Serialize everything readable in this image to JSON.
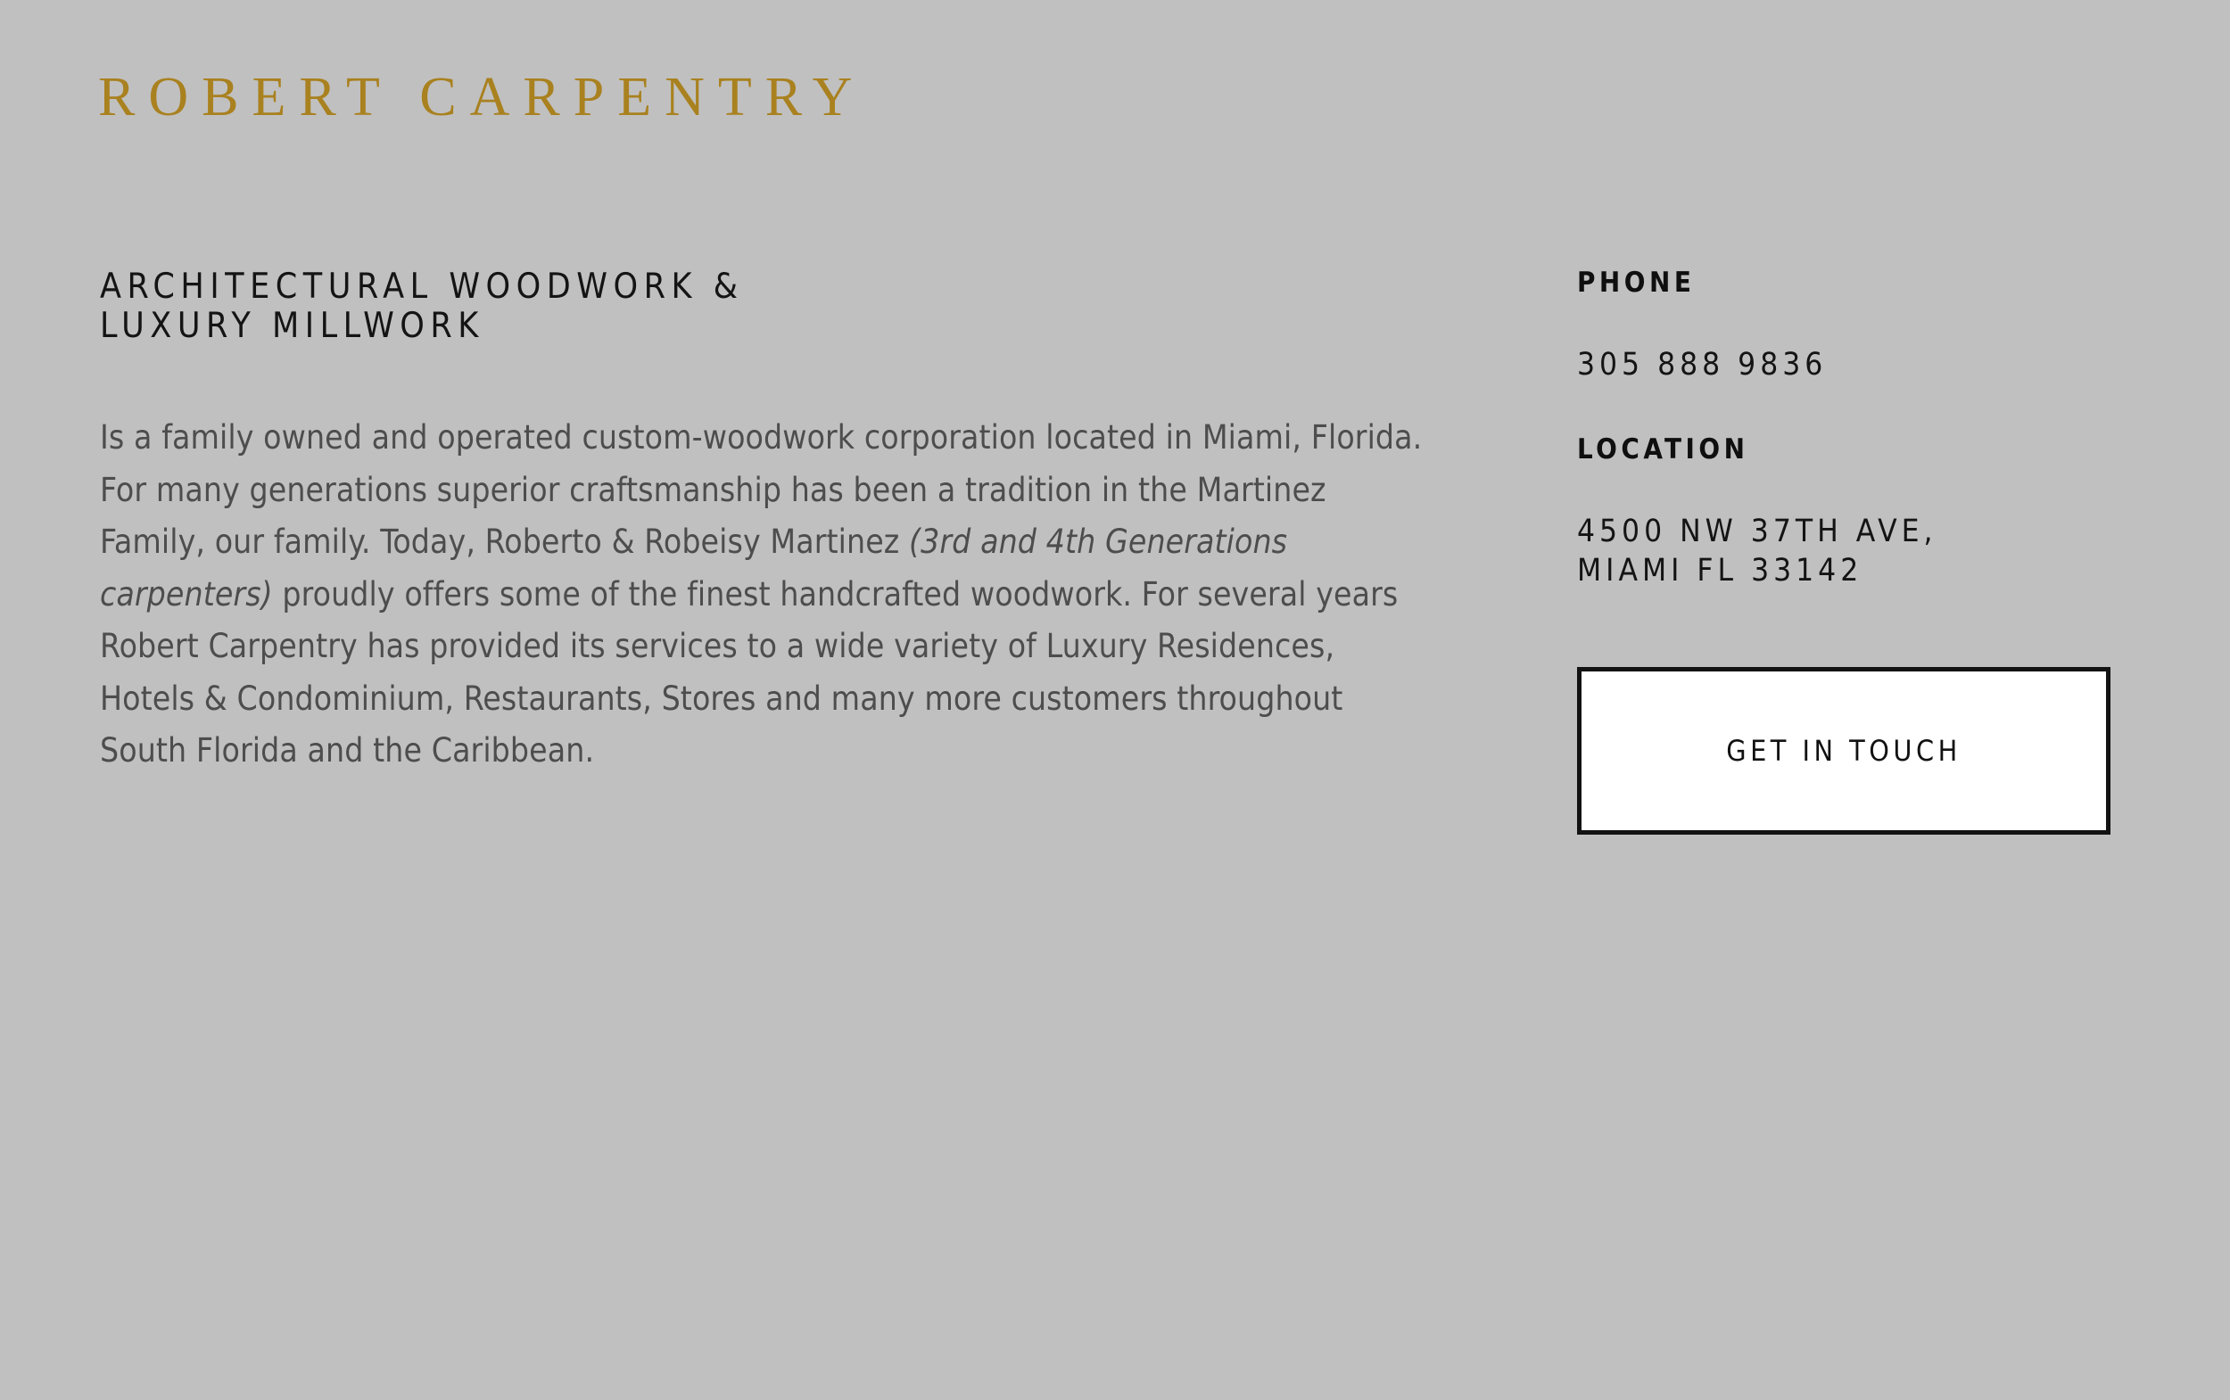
{
  "page": {
    "background_color": "#C0C0C0",
    "brand_gold": "#A9811F",
    "text_dark": "#141414",
    "body_text_color": "#4D4D4D"
  },
  "logo": {
    "text": "ROBERT CARPENTRY"
  },
  "main": {
    "heading": "ARCHITECTURAL WOODWORK &\nLUXURY MILLWORK",
    "body_part_1": "Is a family owned and operated custom-woodwork corporation located in Miami, Florida. For many generations superior craftsmanship has been a tradition in the Martinez Family, our family. Today, Roberto & Robeisy Martinez ",
    "body_italic": "(3rd and 4th Generations carpenters)",
    "body_part_2": " proudly offers some of the finest handcrafted woodwork. For several years Robert Carpentry has provided its services to a wide variety of Luxury Residences, Hotels & Condominium, Restaurants, Stores and many more customers throughout South Florida and the Caribbean."
  },
  "contact": {
    "phone_label": "PHONE",
    "phone_value": "305 888 9836",
    "location_label": "LOCATION",
    "location_value": "4500 NW 37TH AVE,\nMIAMI FL 33142",
    "cta_label": "GET IN TOUCH"
  }
}
